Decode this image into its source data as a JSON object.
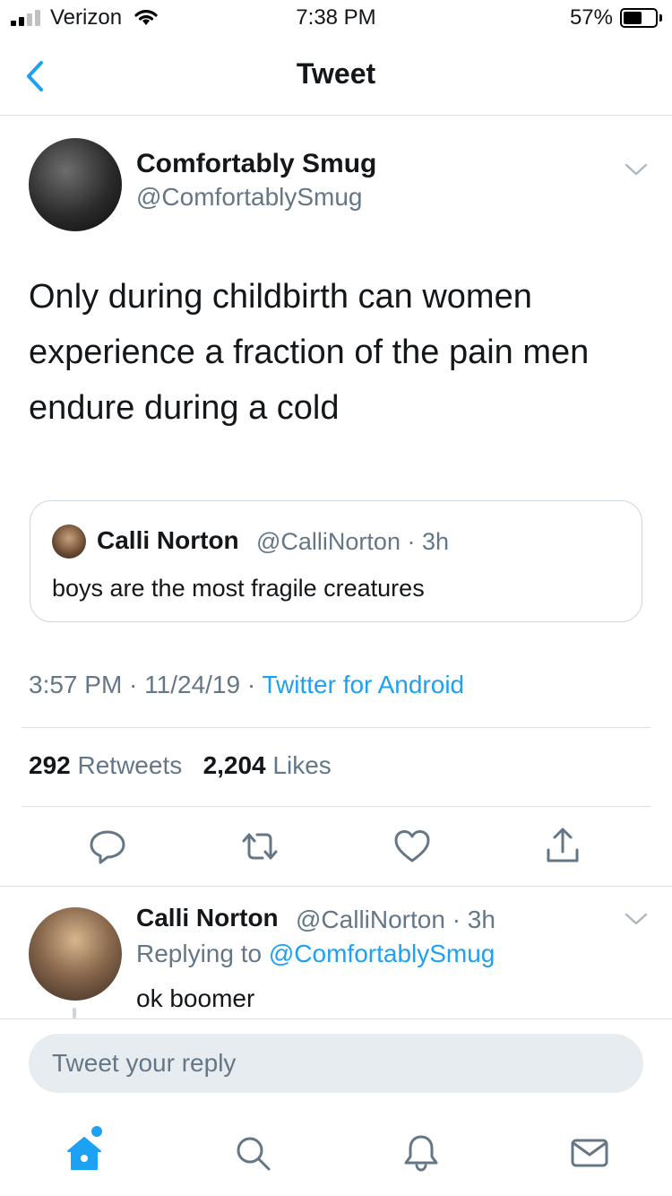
{
  "status_bar": {
    "carrier": "Verizon",
    "time": "7:38 PM",
    "battery_pct": "57%",
    "battery_level": 0.57,
    "signal_bars": 2
  },
  "nav": {
    "title": "Tweet",
    "back_icon": "chevron-left-icon"
  },
  "tweet": {
    "author_name": "Comfortably Smug",
    "author_handle": "@ComfortablySmug",
    "text": "Only during childbirth can women experience a fraction of the pain men endure during a cold",
    "quote": {
      "name": "Calli Norton",
      "handle_time": "@CalliNorton · 3h",
      "text": "boys are the most fragile creatures"
    },
    "timestamp": "3:57 PM · 11/24/19 · ",
    "source": "Twitter for Android",
    "retweets_count": "292",
    "retweets_label": "Retweets",
    "likes_count": "2,204",
    "likes_label": "Likes"
  },
  "actions": [
    "reply-icon",
    "retweet-icon",
    "like-icon",
    "share-icon"
  ],
  "reply": {
    "name": "Calli Norton",
    "handle_time": "@CalliNorton · 3h",
    "replying_prefix": "Replying to ",
    "replying_to": "@ComfortablySmug",
    "text": "ok boomer"
  },
  "compose": {
    "placeholder": "Tweet your reply"
  },
  "tabs": [
    "home-icon",
    "search-icon",
    "notifications-icon",
    "messages-icon"
  ],
  "colors": {
    "accent": "#1da1f2",
    "secondary_text": "#657786",
    "border": "#ccd6dd"
  }
}
